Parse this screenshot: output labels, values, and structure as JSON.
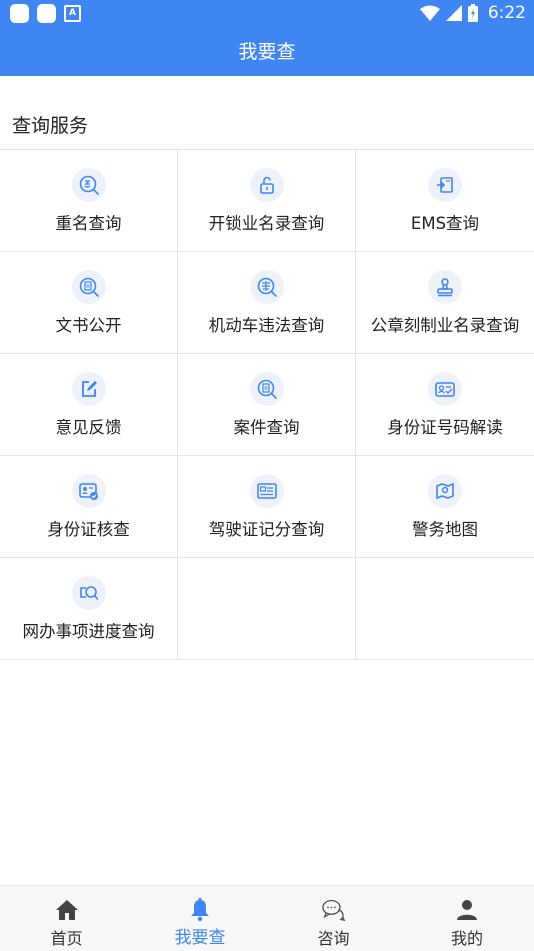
{
  "status_bar": {
    "time": "6:22"
  },
  "title_bar": {
    "title": "我要查"
  },
  "section": {
    "title": "查询服务"
  },
  "accent_color": "#3f86f2",
  "services": [
    {
      "label": "重名查询",
      "icon": "name-search-icon"
    },
    {
      "label": "开锁业名录查询",
      "icon": "unlock-icon"
    },
    {
      "label": "EMS查询",
      "icon": "ems-box-icon"
    },
    {
      "label": "文书公开",
      "icon": "document-search-icon"
    },
    {
      "label": "机动车违法查询",
      "icon": "vehicle-violation-icon"
    },
    {
      "label": "公章刻制业名录查询",
      "icon": "stamp-icon"
    },
    {
      "label": "意见反馈",
      "icon": "feedback-edit-icon"
    },
    {
      "label": "案件查询",
      "icon": "case-search-icon"
    },
    {
      "label": "身份证号码解读",
      "icon": "id-card-icon"
    },
    {
      "label": "身份证核查",
      "icon": "id-verify-icon"
    },
    {
      "label": "驾驶证记分查询",
      "icon": "driver-license-icon"
    },
    {
      "label": "警务地图",
      "icon": "map-icon"
    },
    {
      "label": "网办事项进度查询",
      "icon": "progress-search-icon"
    }
  ],
  "tabs": [
    {
      "label": "首页",
      "icon": "home-icon",
      "active": false
    },
    {
      "label": "我要查",
      "icon": "bell-icon",
      "active": true
    },
    {
      "label": "咨询",
      "icon": "chat-icon",
      "active": false
    },
    {
      "label": "我的",
      "icon": "person-icon",
      "active": false
    }
  ]
}
